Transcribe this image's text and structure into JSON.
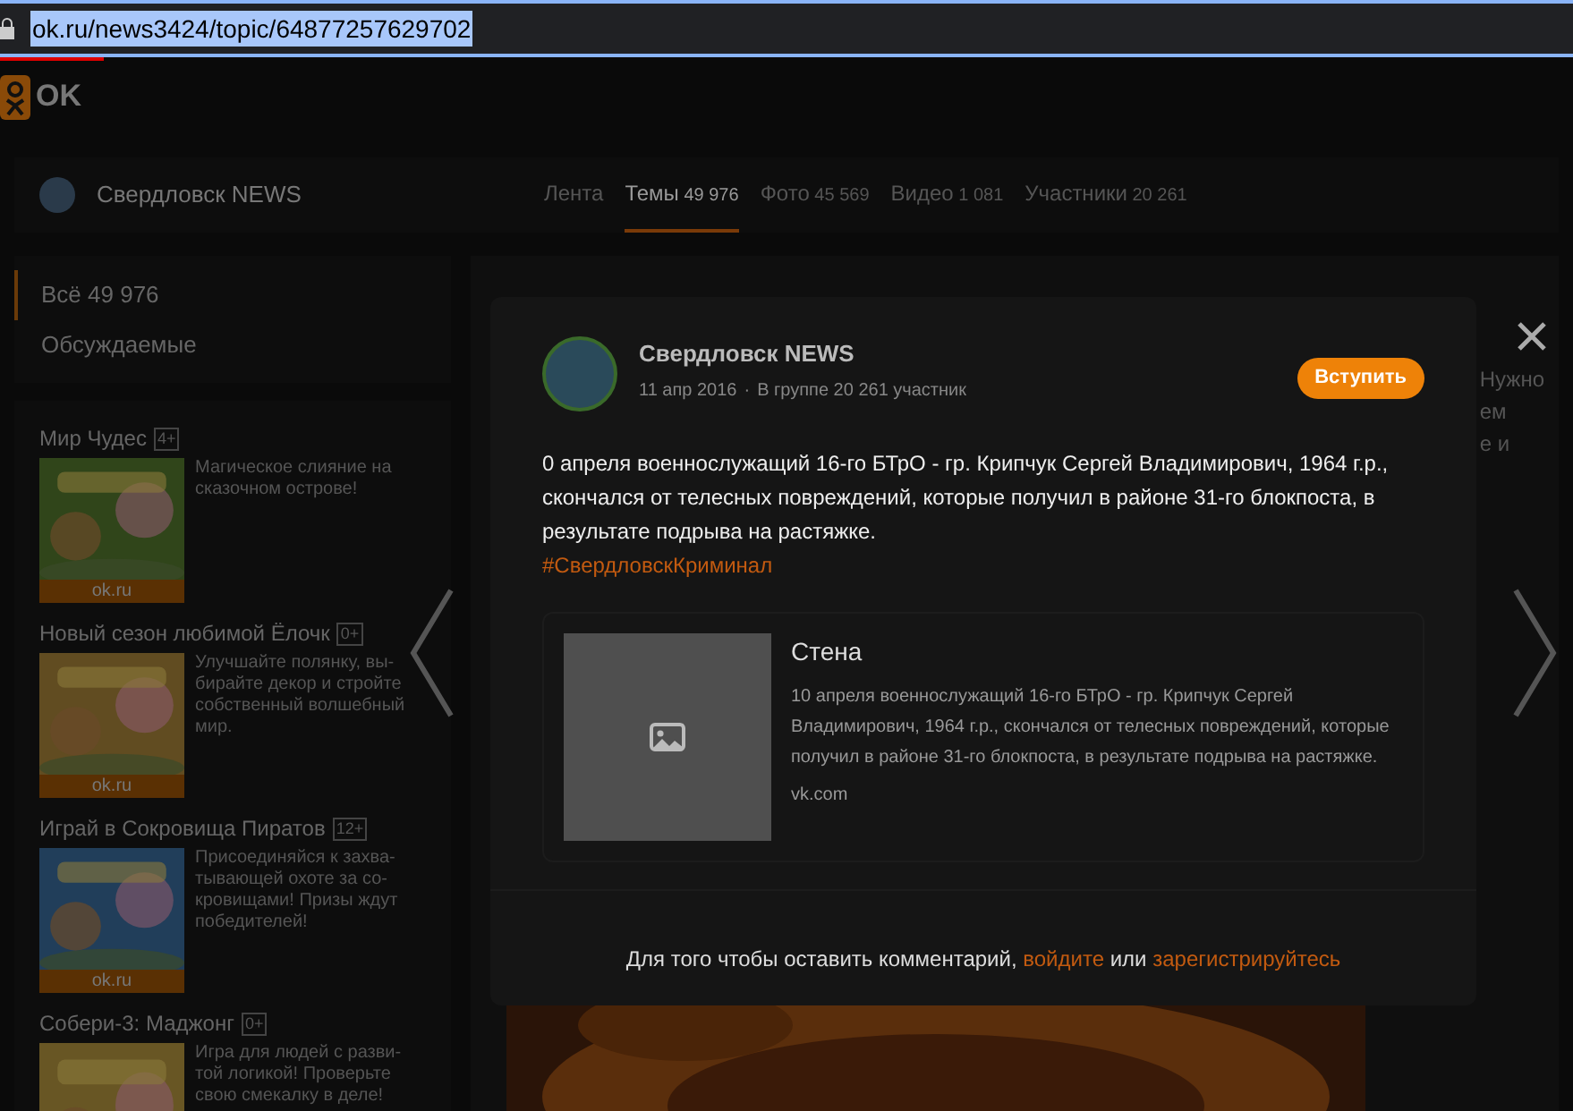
{
  "browser": {
    "url": "ok.ru/news3424/topic/64877257629702"
  },
  "site": {
    "logo": "OK"
  },
  "group_header": {
    "name": "Свердловск NEWS",
    "tabs": [
      {
        "label": "Лента",
        "selected": false
      },
      {
        "label": "Темы",
        "count": "49 976",
        "selected": true
      },
      {
        "label": "Фото",
        "count": "45 569",
        "selected": false
      },
      {
        "label": "Видео",
        "count": "1 081",
        "selected": false
      },
      {
        "label": "Участники",
        "count": "20 261",
        "selected": false
      }
    ]
  },
  "sidebar": {
    "items": [
      {
        "label": "Всё",
        "count": "49 976",
        "selected": true
      },
      {
        "label": "Обсуждаемые",
        "selected": false
      }
    ]
  },
  "ads": [
    {
      "title": "Мир Чудес",
      "age": "4+",
      "source": "ok.ru",
      "text": "Магическое слияние на сказочном острове!"
    },
    {
      "title": "Новый сезон любимой Ёлочк",
      "age": "0+",
      "source": "ok.ru",
      "text": "Улучшайте полянку, вы-бирайте декор и стройте собственный волшебный мир."
    },
    {
      "title": "Играй в Сокровища Пиратов",
      "age": "12+",
      "source": "ok.ru",
      "text": "Присоединяйся к захва-тывающей охоте за со-кровищами! Призы ждут победителей!"
    },
    {
      "title": "Собери-3: Маджонг",
      "age": "0+",
      "text": "Игра для людей с разви-той логикой! Проверьте свою смекалку в деле!"
    }
  ],
  "background_post": {
    "fragments": [
      "Нужно",
      "ем",
      "е и"
    ]
  },
  "modal": {
    "author": "Свердловск NEWS",
    "date": "11 апр 2016",
    "separator": "·",
    "group_info": "В группе 20 261 участник",
    "join_button": "Вступить",
    "text": "0 апреля военнослужащий 16-го БТрО - гр. Крипчук Сергей Владимирович, 1964 г.р., скончался от телесных повреждений, которые получил в районе 31-го блокпоста, в результате подрыва на растяжке.",
    "hashtag": "#СвердловскКриминал",
    "link_card": {
      "title": "Стена",
      "text": "10 апреля военнослужащий 16-го БТрО - гр. Крипчук Сергей Владимирович, 1964 г.р., скончался от телесных повреждений, которые получил в районе 31-го блокпоста, в результате подрыва на растяжке.",
      "domain": "vk.com"
    },
    "comment_prompt": {
      "before": "Для того чтобы оставить комментарий,",
      "login": "войдите",
      "middle": "или",
      "register": "зарегистрируйтесь"
    }
  }
}
